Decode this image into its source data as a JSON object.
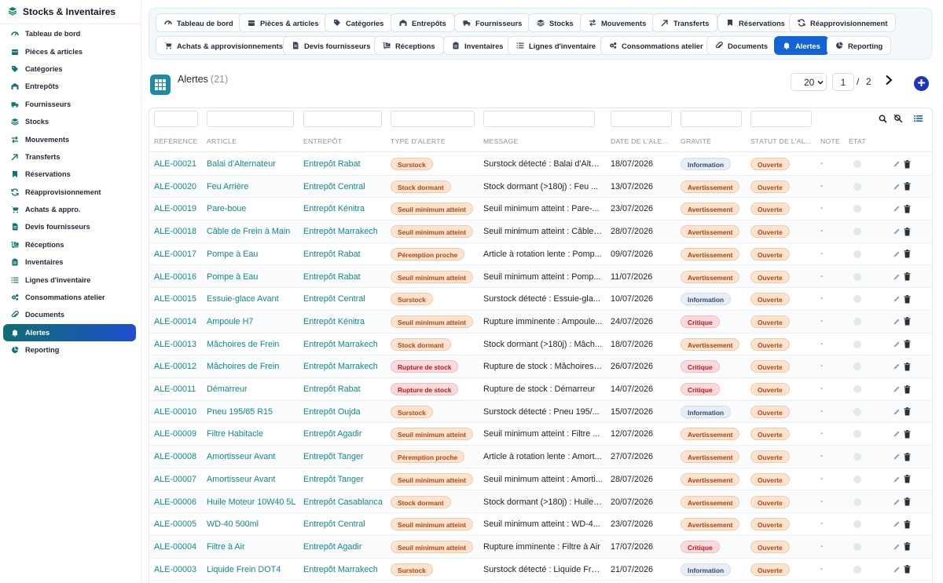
{
  "app": {
    "title": "Stocks & Inventaires"
  },
  "sidebar": {
    "items": [
      {
        "label": "Tableau de bord",
        "icon": "dashboard-icon"
      },
      {
        "label": "Pièces & articles",
        "icon": "box-icon"
      },
      {
        "label": "Catégories",
        "icon": "tag-icon"
      },
      {
        "label": "Entrepôts",
        "icon": "warehouse-icon"
      },
      {
        "label": "Fournisseurs",
        "icon": "truck-icon"
      },
      {
        "label": "Stocks",
        "icon": "layers-icon"
      },
      {
        "label": "Mouvements",
        "icon": "exchange-icon"
      },
      {
        "label": "Transferts",
        "icon": "transfer-icon"
      },
      {
        "label": "Réservations",
        "icon": "bookmark-icon"
      },
      {
        "label": "Réapprovisionnement",
        "icon": "refresh-icon"
      },
      {
        "label": "Achats & appro.",
        "icon": "cart-icon"
      },
      {
        "label": "Devis fournisseurs",
        "icon": "document-icon"
      },
      {
        "label": "Réceptions",
        "icon": "dolly-icon"
      },
      {
        "label": "Inventaires",
        "icon": "clipboard-icon"
      },
      {
        "label": "Lignes d'inventaire",
        "icon": "list-icon"
      },
      {
        "label": "Consommations atelier",
        "icon": "cogs-icon"
      },
      {
        "label": "Documents",
        "icon": "paperclip-icon"
      },
      {
        "label": "Alertes",
        "icon": "bell-icon",
        "active": true
      },
      {
        "label": "Reporting",
        "icon": "pie-chart-icon"
      }
    ]
  },
  "tabs": {
    "row1": [
      {
        "label": "Tableau de bord",
        "icon": "dashboard-icon"
      },
      {
        "label": "Pièces & articles",
        "icon": "box-icon"
      },
      {
        "label": "Catégories",
        "icon": "tag-icon"
      },
      {
        "label": "Entrepôts",
        "icon": "warehouse-icon"
      },
      {
        "label": "Fournisseurs",
        "icon": "truck-icon"
      },
      {
        "label": "Stocks",
        "icon": "layers-icon"
      },
      {
        "label": "Mouvements",
        "icon": "exchange-icon"
      },
      {
        "label": "Transferts",
        "icon": "transfer-icon"
      },
      {
        "label": "Réservations",
        "icon": "bookmark-icon"
      },
      {
        "label": "Réapprovisionnement",
        "icon": "refresh-icon"
      }
    ],
    "row2": [
      {
        "label": "Achats & approvisionnements",
        "icon": "cart-icon"
      },
      {
        "label": "Devis fournisseurs",
        "icon": "document-icon"
      },
      {
        "label": "Réceptions",
        "icon": "dolly-icon"
      },
      {
        "label": "Inventaires",
        "icon": "clipboard-icon"
      },
      {
        "label": "Lignes d'inventaire",
        "icon": "list-icon"
      },
      {
        "label": "Consommations atelier",
        "icon": "cogs-icon"
      },
      {
        "label": "Documents",
        "icon": "paperclip-icon"
      },
      {
        "label": "Alertes",
        "icon": "bell-icon",
        "active": true
      },
      {
        "label": "Reporting",
        "icon": "pie-chart-icon"
      }
    ]
  },
  "header": {
    "title": "Alertes",
    "count": "(21)"
  },
  "pagination": {
    "page_size": "20",
    "current_page": "1",
    "separator": "/",
    "total_pages": "2"
  },
  "table": {
    "columns": [
      "RÉFÉRENCE",
      "ARTICLE",
      "ENTREPÔT",
      "TYPE D'ALERTE",
      "MESSAGE",
      "DATE DE L'ALE...",
      "GRAVITÉ",
      "STATUT DE L'AL...",
      "NOTE",
      "ÉTAT"
    ],
    "rows": [
      {
        "ref": "ALE-00021",
        "article": "Balai d'Alternateur",
        "entrepot": "Entrepôt Rabat",
        "type": "Surstock",
        "message": "Surstock détecté : Balai d'Alte...",
        "date": "18/07/2026",
        "gravite": "Information",
        "statut": "Ouverte",
        "note": "-"
      },
      {
        "ref": "ALE-00020",
        "article": "Feu Arrière",
        "entrepot": "Entrepôt Central",
        "type": "Stock dormant",
        "message": "Stock dormant (>180j) : Feu ...",
        "date": "13/07/2026",
        "gravite": "Avertissement",
        "statut": "Ouverte",
        "note": "-"
      },
      {
        "ref": "ALE-00019",
        "article": "Pare-boue",
        "entrepot": "Entrepôt Kénitra",
        "type": "Seuil minimum atteint",
        "message": "Seuil minimum atteint : Pare-...",
        "date": "23/07/2026",
        "gravite": "Avertissement",
        "statut": "Ouverte",
        "note": "-"
      },
      {
        "ref": "ALE-00018",
        "article": "Câble de Frein à Main",
        "entrepot": "Entrepôt Marrakech",
        "type": "Seuil minimum atteint",
        "message": "Seuil minimum atteint : Câble ...",
        "date": "28/07/2026",
        "gravite": "Avertissement",
        "statut": "Ouverte",
        "note": "-"
      },
      {
        "ref": "ALE-00017",
        "article": "Pompe à Eau",
        "entrepot": "Entrepôt Rabat",
        "type": "Péremption proche",
        "message": "Article à rotation lente : Pomp...",
        "date": "09/07/2026",
        "gravite": "Avertissement",
        "statut": "Ouverte",
        "note": "-"
      },
      {
        "ref": "ALE-00016",
        "article": "Pompe à Eau",
        "entrepot": "Entrepôt Rabat",
        "type": "Seuil minimum atteint",
        "message": "Seuil minimum atteint : Pomp...",
        "date": "11/07/2026",
        "gravite": "Avertissement",
        "statut": "Ouverte",
        "note": "-"
      },
      {
        "ref": "ALE-00015",
        "article": "Essuie-glace Avant",
        "entrepot": "Entrepôt Central",
        "type": "Surstock",
        "message": "Surstock détecté : Essuie-gla...",
        "date": "10/07/2026",
        "gravite": "Information",
        "statut": "Ouverte",
        "note": "-"
      },
      {
        "ref": "ALE-00014",
        "article": "Ampoule H7",
        "entrepot": "Entrepôt Kénitra",
        "type": "Seuil minimum atteint",
        "message": "Rupture imminente : Ampoule...",
        "date": "24/07/2026",
        "gravite": "Critique",
        "statut": "Ouverte",
        "note": "-"
      },
      {
        "ref": "ALE-00013",
        "article": "Mâchoires de Frein",
        "entrepot": "Entrepôt Marrakech",
        "type": "Stock dormant",
        "message": "Stock dormant (>180j) : Mâch...",
        "date": "18/07/2026",
        "gravite": "Avertissement",
        "statut": "Ouverte",
        "note": "-"
      },
      {
        "ref": "ALE-00012",
        "article": "Mâchoires de Frein",
        "entrepot": "Entrepôt Marrakech",
        "type": "Rupture de stock",
        "message": "Rupture de stock : Mâchoires ...",
        "date": "26/07/2026",
        "gravite": "Critique",
        "statut": "Ouverte",
        "note": "-"
      },
      {
        "ref": "ALE-00011",
        "article": "Démarreur",
        "entrepot": "Entrepôt Rabat",
        "type": "Rupture de stock",
        "message": "Rupture de stock : Démarreur",
        "date": "14/07/2026",
        "gravite": "Critique",
        "statut": "Ouverte",
        "note": "-"
      },
      {
        "ref": "ALE-00010",
        "article": "Pneu 195/65 R15",
        "entrepot": "Entrepôt Oujda",
        "type": "Surstock",
        "message": "Surstock détecté : Pneu 195/...",
        "date": "15/07/2026",
        "gravite": "Information",
        "statut": "Ouverte",
        "note": "-"
      },
      {
        "ref": "ALE-00009",
        "article": "Filtre Habitacle",
        "entrepot": "Entrepôt Agadir",
        "type": "Seuil minimum atteint",
        "message": "Seuil minimum atteint : Filtre ...",
        "date": "12/07/2026",
        "gravite": "Avertissement",
        "statut": "Ouverte",
        "note": "-"
      },
      {
        "ref": "ALE-00008",
        "article": "Amortisseur Avant",
        "entrepot": "Entrepôt Tanger",
        "type": "Péremption proche",
        "message": "Article à rotation lente : Amort...",
        "date": "27/07/2026",
        "gravite": "Avertissement",
        "statut": "Ouverte",
        "note": "-"
      },
      {
        "ref": "ALE-00007",
        "article": "Amortisseur Avant",
        "entrepot": "Entrepôt Tanger",
        "type": "Seuil minimum atteint",
        "message": "Seuil minimum atteint : Amorti...",
        "date": "28/07/2026",
        "gravite": "Avertissement",
        "statut": "Ouverte",
        "note": "-"
      },
      {
        "ref": "ALE-00006",
        "article": "Huile Moteur 10W40 5L",
        "entrepot": "Entrepôt Casablanca",
        "type": "Stock dormant",
        "message": "Stock dormant (>180j) : Huile ...",
        "date": "20/07/2026",
        "gravite": "Avertissement",
        "statut": "Ouverte",
        "note": "-"
      },
      {
        "ref": "ALE-00005",
        "article": "WD-40 500ml",
        "entrepot": "Entrepôt Central",
        "type": "Seuil minimum atteint",
        "message": "Seuil minimum atteint : WD-4...",
        "date": "23/07/2026",
        "gravite": "Avertissement",
        "statut": "Ouverte",
        "note": "-"
      },
      {
        "ref": "ALE-00004",
        "article": "Filtre à Air",
        "entrepot": "Entrepôt Agadir",
        "type": "Seuil minimum atteint",
        "message": "Rupture imminente : Filtre à Air",
        "date": "17/07/2026",
        "gravite": "Critique",
        "statut": "Ouverte",
        "note": "-"
      },
      {
        "ref": "ALE-00003",
        "article": "Liquide Frein DOT4",
        "entrepot": "Entrepôt Marrakech",
        "type": "Surstock",
        "message": "Surstock détecté : Liquide Fre...",
        "date": "21/07/2026",
        "gravite": "Information",
        "statut": "Ouverte",
        "note": "-"
      }
    ]
  },
  "colors": {
    "accent": "#1363d7",
    "teal": "#0f8a8a",
    "sidebar_active_start": "#0f6d72",
    "sidebar_active_end": "#1f4fd1",
    "add_button": "#1d35b8"
  }
}
